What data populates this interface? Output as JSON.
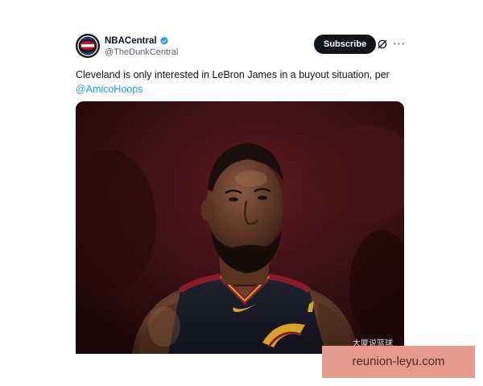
{
  "post": {
    "author": {
      "display_name": "NBACentral",
      "handle": "@TheDunkCentral",
      "avatar_icon": "nba-central-logo",
      "verified_color": "#1d9bf0"
    },
    "subscribe_label": "Subscribe",
    "text_body": "Cleveland is only interested in LeBron James in a buyout situation, per",
    "mention": "@AmicoHoops",
    "media_description": "basketball-player-photo"
  },
  "watermarks": {
    "overlay_text": "大厦说篮球",
    "banner_text": "reunion-leyu.com",
    "banner_color": "#e69a8c"
  }
}
